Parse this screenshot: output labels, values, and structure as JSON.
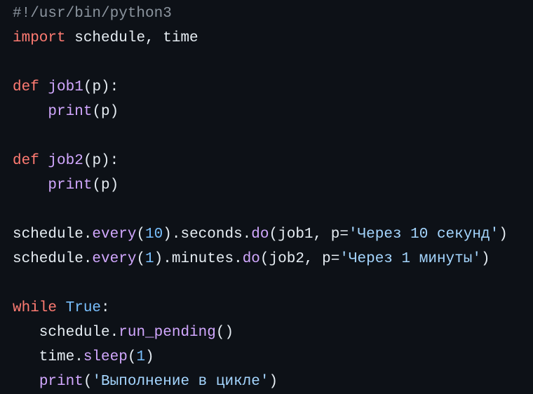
{
  "theme": {
    "background": "#0d1117",
    "text": "#e6edf3",
    "keyword": "#ff7b72",
    "function": "#d2a8ff",
    "number": "#79c0ff",
    "string": "#a5d6ff",
    "comment": "#8b949e"
  },
  "code": {
    "lines": [
      [
        {
          "t": "#!/usr/bin/python3",
          "c": "cmt"
        }
      ],
      [
        {
          "t": "import",
          "c": "kw"
        },
        {
          "t": " schedule, time",
          "c": "plain"
        }
      ],
      [],
      [
        {
          "t": "def",
          "c": "kw"
        },
        {
          "t": " ",
          "c": "plain"
        },
        {
          "t": "job1",
          "c": "fn"
        },
        {
          "t": "(p):",
          "c": "plain"
        }
      ],
      [
        {
          "t": "    ",
          "c": "plain"
        },
        {
          "t": "print",
          "c": "fn"
        },
        {
          "t": "(p)",
          "c": "plain"
        }
      ],
      [],
      [
        {
          "t": "def",
          "c": "kw"
        },
        {
          "t": " ",
          "c": "plain"
        },
        {
          "t": "job2",
          "c": "fn"
        },
        {
          "t": "(p):",
          "c": "plain"
        }
      ],
      [
        {
          "t": "    ",
          "c": "plain"
        },
        {
          "t": "print",
          "c": "fn"
        },
        {
          "t": "(p)",
          "c": "plain"
        }
      ],
      [],
      [
        {
          "t": "schedule.",
          "c": "plain"
        },
        {
          "t": "every",
          "c": "fn"
        },
        {
          "t": "(",
          "c": "plain"
        },
        {
          "t": "10",
          "c": "num"
        },
        {
          "t": ").seconds.",
          "c": "plain"
        },
        {
          "t": "do",
          "c": "fn"
        },
        {
          "t": "(job1, p=",
          "c": "plain"
        },
        {
          "t": "'Через 10 секунд'",
          "c": "str"
        },
        {
          "t": ")",
          "c": "plain"
        }
      ],
      [
        {
          "t": "schedule.",
          "c": "plain"
        },
        {
          "t": "every",
          "c": "fn"
        },
        {
          "t": "(",
          "c": "plain"
        },
        {
          "t": "1",
          "c": "num"
        },
        {
          "t": ").minutes.",
          "c": "plain"
        },
        {
          "t": "do",
          "c": "fn"
        },
        {
          "t": "(job2, p=",
          "c": "plain"
        },
        {
          "t": "'Через 1 минуты'",
          "c": "str"
        },
        {
          "t": ")",
          "c": "plain"
        }
      ],
      [],
      [
        {
          "t": "while",
          "c": "kw"
        },
        {
          "t": " ",
          "c": "plain"
        },
        {
          "t": "True",
          "c": "num"
        },
        {
          "t": ":",
          "c": "plain"
        }
      ],
      [
        {
          "t": "   schedule.",
          "c": "plain"
        },
        {
          "t": "run_pending",
          "c": "fn"
        },
        {
          "t": "()",
          "c": "plain"
        }
      ],
      [
        {
          "t": "   time.",
          "c": "plain"
        },
        {
          "t": "sleep",
          "c": "fn"
        },
        {
          "t": "(",
          "c": "plain"
        },
        {
          "t": "1",
          "c": "num"
        },
        {
          "t": ")",
          "c": "plain"
        }
      ],
      [
        {
          "t": "   ",
          "c": "plain"
        },
        {
          "t": "print",
          "c": "fn"
        },
        {
          "t": "(",
          "c": "plain"
        },
        {
          "t": "'Выполнение в цикле'",
          "c": "str"
        },
        {
          "t": ")",
          "c": "plain"
        }
      ]
    ]
  }
}
